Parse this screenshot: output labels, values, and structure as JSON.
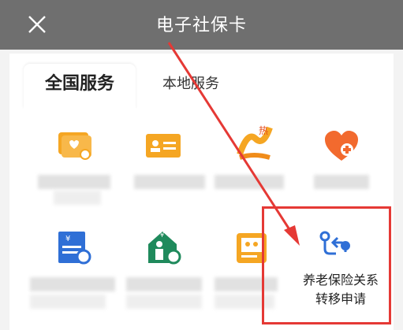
{
  "header": {
    "title": "电子社保卡"
  },
  "tabs": [
    {
      "label": "全国服务",
      "active": true
    },
    {
      "label": "本地服务",
      "active": false
    }
  ],
  "featured_service": {
    "label_line1": "养老保险关系",
    "label_line2": "转移申请"
  },
  "colors": {
    "header_bg": "#6f6f6f",
    "accent_orange": "#f5a623",
    "icon_blue": "#2f6fd6",
    "icon_green": "#1f8a5c",
    "highlight_red": "#e53935"
  },
  "icons": {
    "close": "close-icon",
    "row1": [
      "card-icon",
      "id-card-icon",
      "hot-service-icon",
      "heart-plus-icon"
    ],
    "row2": [
      "bill-icon",
      "house-person-icon",
      "photo-card-icon",
      "route-transfer-icon"
    ]
  }
}
